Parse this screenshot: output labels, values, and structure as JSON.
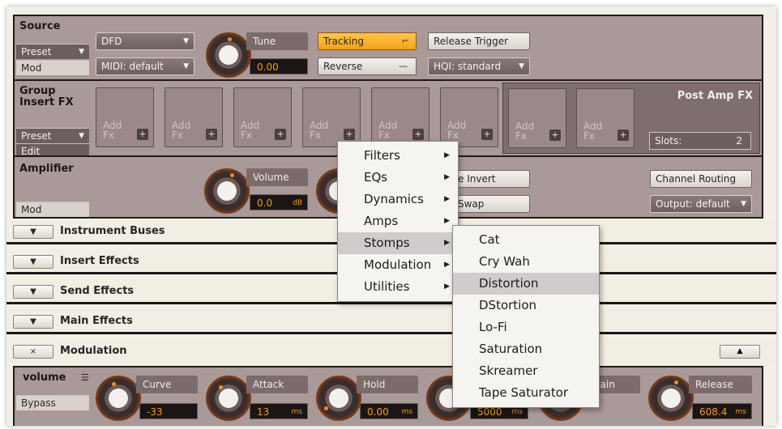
{
  "source": {
    "title": "Source",
    "preset_label": "Preset",
    "mod_label": "Mod",
    "engine_value": "DFD",
    "midi_value": "MIDI: default",
    "tune_label": "Tune",
    "tune_value": "0.00",
    "tracking_label": "Tracking",
    "reverse_label": "Reverse",
    "release_trigger_label": "Release Trigger",
    "hq_value": "HQI: standard"
  },
  "group_insert": {
    "title_line1": "Group",
    "title_line2": "Insert FX",
    "preset_label": "Preset",
    "edit_label": "Edit",
    "slot_text_line1": "Add",
    "slot_text_line2": "Fx",
    "slot_plus": "+",
    "post_amp_title": "Post Amp FX",
    "slots_label": "Slots:",
    "slots_value": "2"
  },
  "amplifier": {
    "title": "Amplifier",
    "mod_label": "Mod",
    "volume_label": "Volume",
    "volume_value": "0.0",
    "volume_unit": "dB",
    "phase_invert_label": "e Invert",
    "swap_label": "Swap",
    "channel_routing_label": "Channel Routing",
    "output_value": "Output: default"
  },
  "bars": [
    {
      "label": "Instrument Buses",
      "toggle": "▼"
    },
    {
      "label": "Insert Effects",
      "toggle": "▼"
    },
    {
      "label": "Send Effects",
      "toggle": "▼"
    },
    {
      "label": "Main Effects",
      "toggle": "▼"
    },
    {
      "label": "Modulation",
      "toggle": "×"
    }
  ],
  "modulation": {
    "volume_label": "volume",
    "bypass_label": "Bypass",
    "curve_label": "Curve",
    "curve_value": "-33",
    "attack_label": "Attack",
    "attack_value": "13",
    "attack_unit": "ms",
    "hold_label": "Hold",
    "hold_value": "0.00",
    "hold_unit": "ms",
    "decay_value": "5000",
    "decay_unit": "ms",
    "sustain_label": "ustain",
    "release_label": "Release",
    "release_value": "608.4",
    "release_unit": "ms"
  },
  "context_menu": {
    "items": [
      {
        "label": "Filters"
      },
      {
        "label": "EQs"
      },
      {
        "label": "Dynamics"
      },
      {
        "label": "Amps"
      },
      {
        "label": "Stomps",
        "highlighted": true
      },
      {
        "label": "Modulation"
      },
      {
        "label": "Utilities"
      }
    ],
    "submenu_arrow": "▶"
  },
  "stomps_submenu": {
    "items": [
      {
        "label": "Cat"
      },
      {
        "label": "Cry Wah"
      },
      {
        "label": "Distortion",
        "highlighted": true
      },
      {
        "label": "DStortion"
      },
      {
        "label": "Lo-Fi"
      },
      {
        "label": "Saturation"
      },
      {
        "label": "Skreamer"
      },
      {
        "label": "Tape Saturator"
      }
    ]
  },
  "icons": {
    "dropdown_arrow": "▼",
    "tracking_icon": "step-curve-icon",
    "reverse_icon": "reverse-line-icon"
  },
  "colors": {
    "panel": "#a99998",
    "accent_orange": "#f59a1a",
    "tracking_on": "#ffb62a",
    "menu_highlight": "#cfcccb"
  }
}
